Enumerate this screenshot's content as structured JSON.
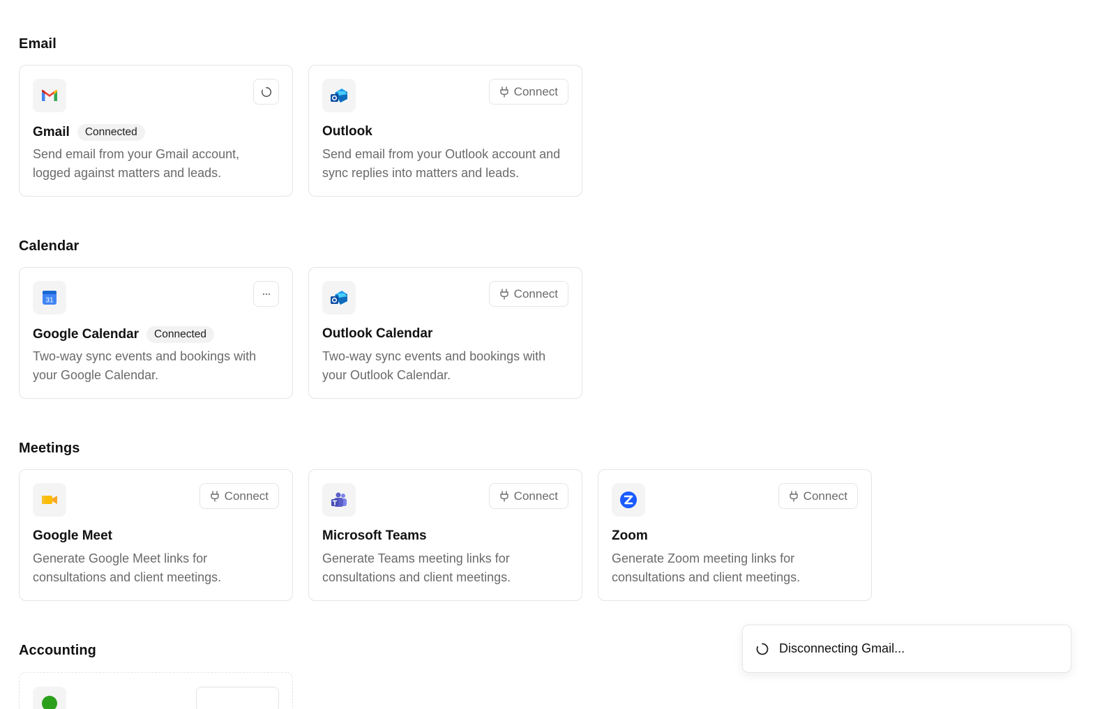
{
  "sections": {
    "email": {
      "title": "Email",
      "gmail": {
        "name": "Gmail",
        "badge": "Connected",
        "description": "Send email from your Gmail account, logged against matters and leads."
      },
      "outlook": {
        "name": "Outlook",
        "connect_label": "Connect",
        "description": "Send email from your Outlook account and sync replies into matters and leads."
      }
    },
    "calendar": {
      "title": "Calendar",
      "google_calendar": {
        "name": "Google Calendar",
        "badge": "Connected",
        "description": "Two-way sync events and bookings with your Google Calendar.",
        "logo_text": "31"
      },
      "outlook_calendar": {
        "name": "Outlook Calendar",
        "connect_label": "Connect",
        "description": "Two-way sync events and bookings with your Outlook Calendar."
      }
    },
    "meetings": {
      "title": "Meetings",
      "google_meet": {
        "name": "Google Meet",
        "connect_label": "Connect",
        "description": "Generate Google Meet links for consultations and client meetings."
      },
      "microsoft_teams": {
        "name": "Microsoft Teams",
        "connect_label": "Connect",
        "description": "Generate Teams meeting links for consultations and client meetings."
      },
      "zoom": {
        "name": "Zoom",
        "connect_label": "Connect",
        "description": "Generate Zoom meeting links for consultations and client meetings."
      }
    },
    "accounting": {
      "title": "Accounting"
    }
  },
  "toast": {
    "message": "Disconnecting Gmail..."
  },
  "icons": {
    "gmail": "gmail-logo-icon",
    "outlook": "outlook-logo-icon",
    "google_calendar": "google-calendar-logo-icon",
    "google_meet": "google-meet-logo-icon",
    "microsoft_teams": "teams-logo-icon",
    "zoom": "zoom-logo-icon",
    "connect": "plug-icon",
    "loading": "spinner-icon",
    "more": "ellipsis-icon"
  },
  "colors": {
    "border": "#e4e4e4",
    "muted_text": "#6a6a6a",
    "badge_bg": "#f2f2f3",
    "zoom_blue": "#1a5bff",
    "gmail_red": "#ea4335",
    "meet_yellow": "#fbbc04",
    "teams_purple": "#5b5fc7",
    "outlook_blue": "#0f6cbd"
  }
}
